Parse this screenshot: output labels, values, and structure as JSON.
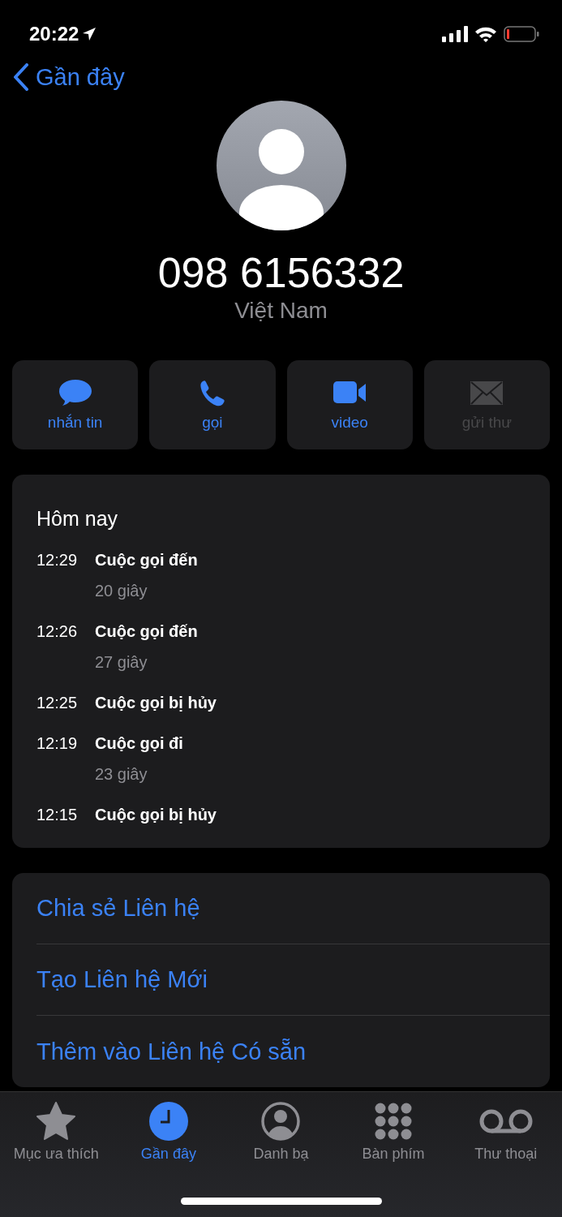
{
  "status_bar": {
    "time": "20:22"
  },
  "nav": {
    "back_label": "Gần đây"
  },
  "contact": {
    "number": "098 6156332",
    "country": "Việt Nam"
  },
  "actions": [
    {
      "kind": "message",
      "label": "nhắn tin",
      "disabled": false
    },
    {
      "kind": "call",
      "label": "gọi",
      "disabled": false
    },
    {
      "kind": "video",
      "label": "video",
      "disabled": false
    },
    {
      "kind": "mail",
      "label": "gửi thư",
      "disabled": true
    }
  ],
  "history": {
    "title": "Hôm nay",
    "calls": [
      {
        "time": "12:29",
        "type": "Cuộc gọi đến",
        "duration": "20 giây"
      },
      {
        "time": "12:26",
        "type": "Cuộc gọi đến",
        "duration": "27 giây"
      },
      {
        "time": "12:25",
        "type": "Cuộc gọi bị hủy"
      },
      {
        "time": "12:19",
        "type": "Cuộc gọi đi",
        "duration": "23 giây"
      },
      {
        "time": "12:15",
        "type": "Cuộc gọi bị hủy"
      }
    ]
  },
  "options": [
    "Chia sẻ Liên hệ",
    "Tạo Liên hệ Mới",
    "Thêm vào Liên hệ Có sẵn"
  ],
  "tabs": [
    {
      "kind": "favorites",
      "label": "Mục ưa thích",
      "selected": false
    },
    {
      "kind": "recents",
      "label": "Gần đây",
      "selected": true
    },
    {
      "kind": "contacts",
      "label": "Danh bạ",
      "selected": false
    },
    {
      "kind": "keypad",
      "label": "Bàn phím",
      "selected": false
    },
    {
      "kind": "voicemail",
      "label": "Thư thoại",
      "selected": false
    }
  ]
}
